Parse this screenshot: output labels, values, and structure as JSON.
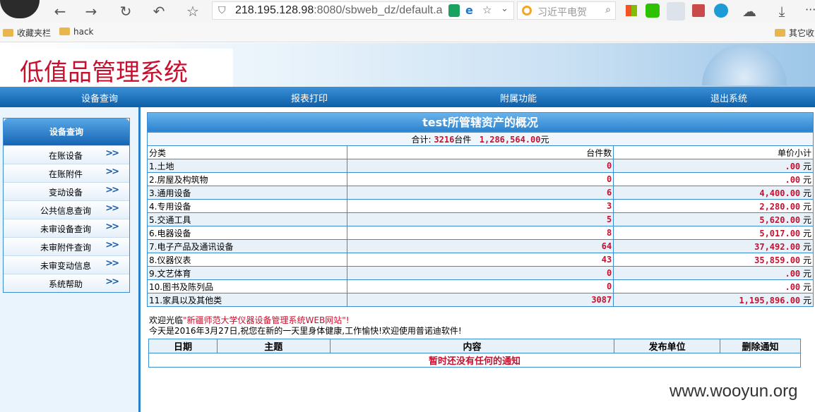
{
  "browser": {
    "url_host": "218.195.128.98",
    "url_rest": ":8080/sbweb_dz/default.a",
    "search_placeholder": "习近平电贺",
    "bookmarks": [
      "收藏夹栏",
      "hack"
    ],
    "other_bookmarks": "其它收",
    "more": "···"
  },
  "header": {
    "system_title": "低值品管理系统",
    "nav": [
      "设备查询",
      "报表打印",
      "附属功能",
      "退出系统"
    ]
  },
  "sidebar": {
    "heading": "设备查询",
    "arrow": ">>",
    "items": [
      "在账设备",
      "在账附件",
      "变动设备",
      "公共信息查询",
      "未审设备查询",
      "未审附件查询",
      "未审变动信息",
      "系统帮助"
    ]
  },
  "summary": {
    "title": "test所管辖资产的概况",
    "total_prefix": "合计:",
    "total_count": "3216",
    "count_unit": "台件",
    "total_amount": "1,286,564.00",
    "amount_unit": "元",
    "columns": [
      "分类",
      "台件数",
      "单价小计"
    ],
    "currency": "元",
    "rows": [
      {
        "category": "1.土地",
        "count": "0",
        "subtotal": ".00"
      },
      {
        "category": "2.房屋及构筑物",
        "count": "0",
        "subtotal": ".00"
      },
      {
        "category": "3.通用设备",
        "count": "6",
        "subtotal": "4,400.00"
      },
      {
        "category": "4.专用设备",
        "count": "3",
        "subtotal": "2,280.00"
      },
      {
        "category": "5.交通工具",
        "count": "5",
        "subtotal": "5,620.00"
      },
      {
        "category": "6.电器设备",
        "count": "8",
        "subtotal": "5,017.00"
      },
      {
        "category": "7.电子产品及通讯设备",
        "count": "64",
        "subtotal": "37,492.00"
      },
      {
        "category": "8.仪器仪表",
        "count": "43",
        "subtotal": "35,859.00"
      },
      {
        "category": "9.文艺体育",
        "count": "0",
        "subtotal": ".00"
      },
      {
        "category": "10.图书及陈列品",
        "count": "0",
        "subtotal": ".00"
      },
      {
        "category": "11.家具以及其他类",
        "count": "3087",
        "subtotal": "1,195,896.00"
      }
    ]
  },
  "welcome": {
    "prefix": "欢迎光临",
    "site": "\"新疆师范大学仪器设备管理系统WEB网站\"!",
    "line2": "今天是2016年3月27日,祝您在新的一天里身体健康,工作愉快!欢迎使用普诺迪软件!"
  },
  "notices": {
    "columns": [
      "日期",
      "主题",
      "内容",
      "发布单位",
      "删除通知"
    ],
    "empty_message": "暂时还没有任何的通知"
  },
  "watermark": "www.wooyun.org"
}
